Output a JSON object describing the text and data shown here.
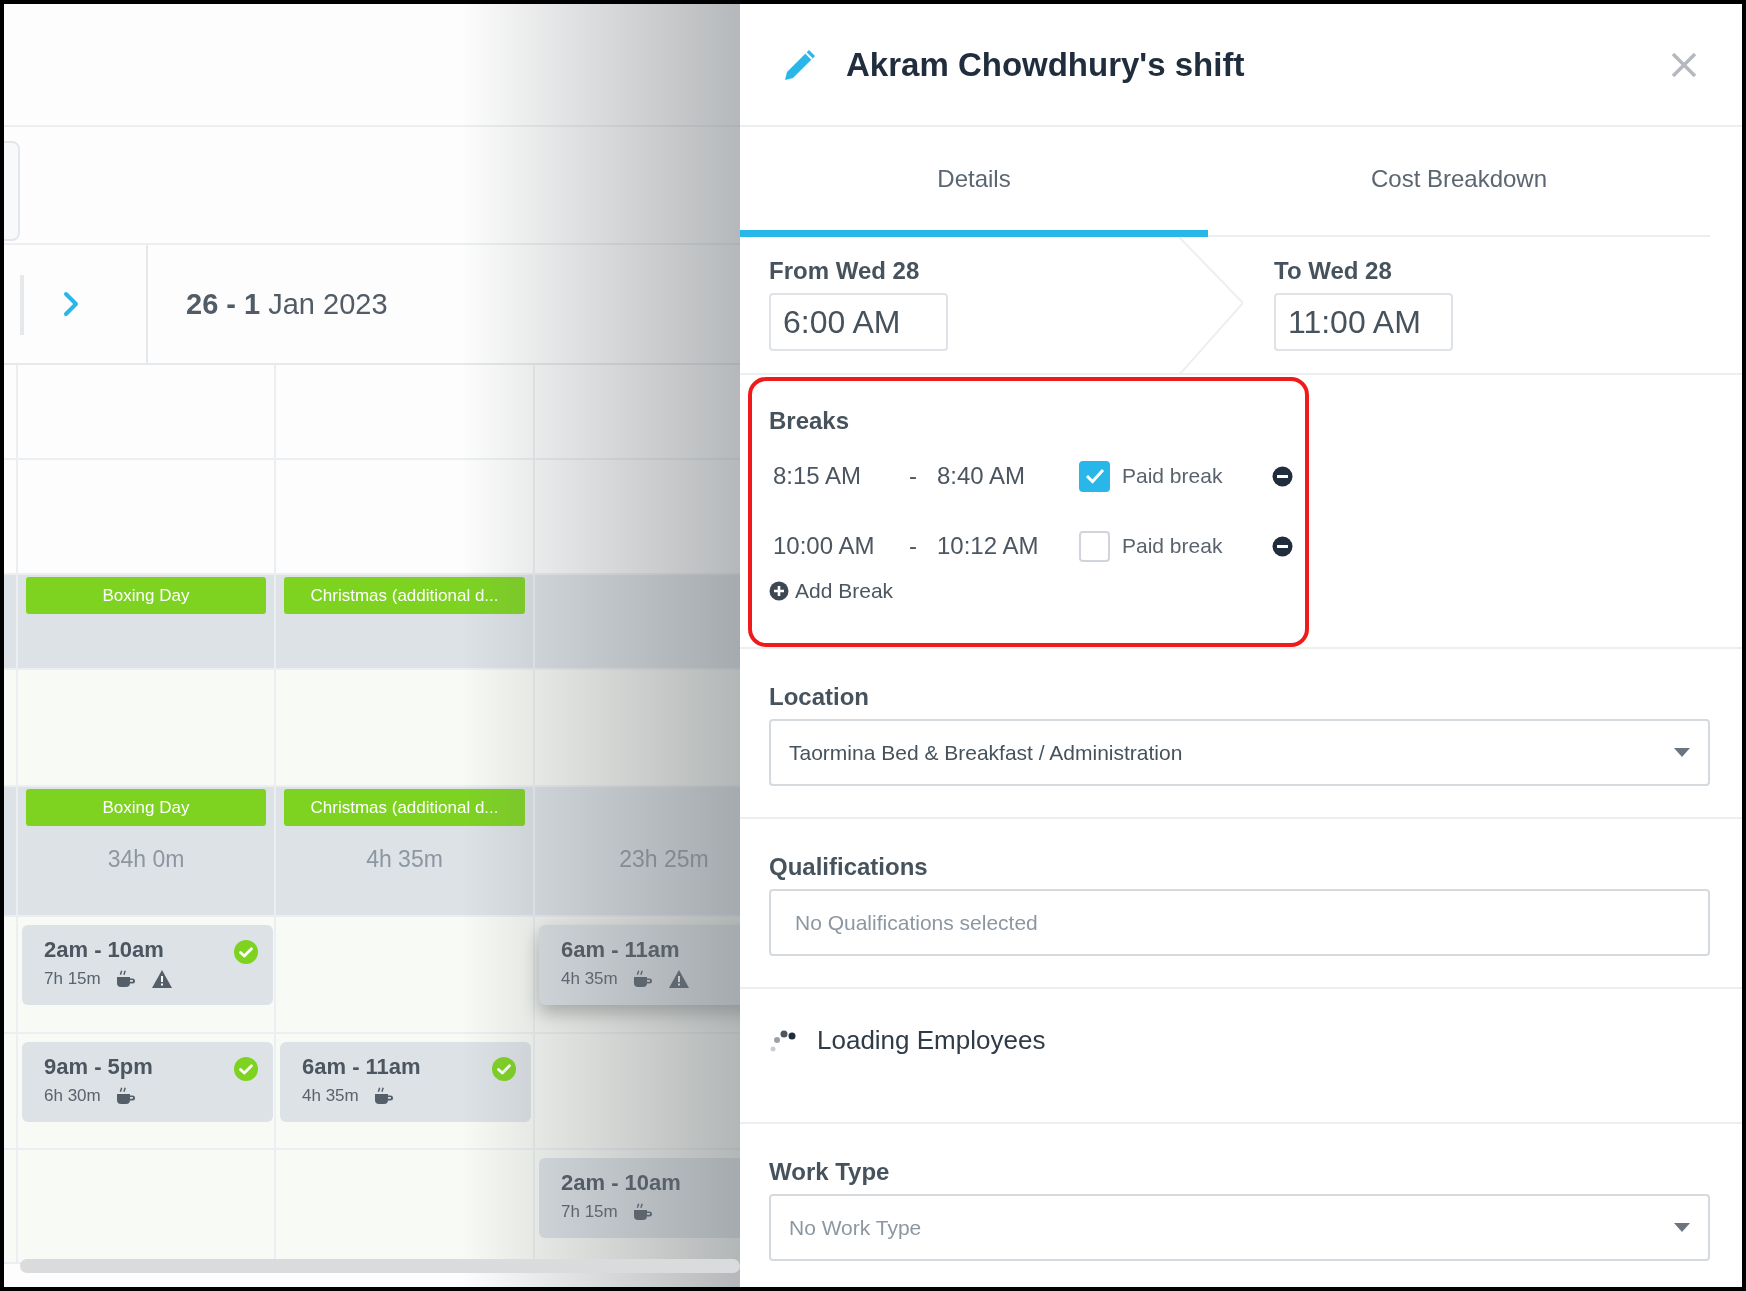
{
  "calendar": {
    "date_range": "**26 - 1** Jan 2023",
    "rows": [
      {
        "kind": "blank"
      },
      {
        "kind": "blank"
      },
      {
        "kind": "holiday",
        "cells": [
          {
            "holiday": "Boxing Day"
          },
          {
            "holiday": "Christmas (additional d..."
          },
          null
        ]
      },
      {
        "kind": "shifts",
        "cells": [
          null,
          null,
          null
        ]
      },
      {
        "kind": "holiday",
        "cells": [
          {
            "holiday": "Boxing Day",
            "total": "34h 0m"
          },
          {
            "holiday": "Christmas (additional d...",
            "total": "4h 35m"
          },
          {
            "total": "23h 25m"
          }
        ]
      },
      {
        "kind": "shifts",
        "cells": [
          {
            "time": "2am - 10am",
            "duration": "7h 15m",
            "approved": true,
            "warning": true,
            "selected": false
          },
          null,
          {
            "time": "6am - 11am",
            "duration": "4h 35m",
            "approved": false,
            "warning": true,
            "selected": true
          }
        ]
      },
      {
        "kind": "shifts",
        "cells": [
          {
            "time": "9am - 5pm",
            "duration": "6h 30m",
            "approved": true,
            "warning": false,
            "selected": false
          },
          {
            "time": "6am - 11am",
            "duration": "4h 35m",
            "approved": true,
            "warning": false,
            "selected": false
          },
          null
        ]
      },
      {
        "kind": "shifts",
        "cells": [
          null,
          null,
          {
            "time": "2am - 10am",
            "duration": "7h 15m",
            "approved": false,
            "warning": false,
            "selected": false
          }
        ]
      }
    ]
  },
  "shift_panel": {
    "title": "Akram Chowdhury's shift",
    "tabs": [
      {
        "label": "Details",
        "selected": true
      },
      {
        "label": "Cost Breakdown",
        "selected": false
      }
    ],
    "from": {
      "label": "From Wed 28",
      "value": "6:00 AM"
    },
    "to": {
      "label": "To Wed 28",
      "value": "11:00 AM"
    },
    "breaks": {
      "label": "Breaks",
      "highlighted": true,
      "items": [
        {
          "start": "8:15 AM",
          "separator": "-",
          "end": "8:40 AM",
          "paid": true,
          "paid_label": "Paid break"
        },
        {
          "start": "10:00 AM",
          "separator": "-",
          "end": "10:12 AM",
          "paid": false,
          "paid_label": "Paid break"
        }
      ],
      "add_label": "Add Break"
    },
    "location": {
      "label": "Location",
      "value": "Taormina Bed & Breakfast / Administration"
    },
    "qualifications": {
      "label": "Qualifications",
      "placeholder": "No Qualifications selected"
    },
    "employees": {
      "status": "Loading Employees"
    },
    "work_type": {
      "label": "Work Type",
      "placeholder": "No Work Type"
    }
  }
}
